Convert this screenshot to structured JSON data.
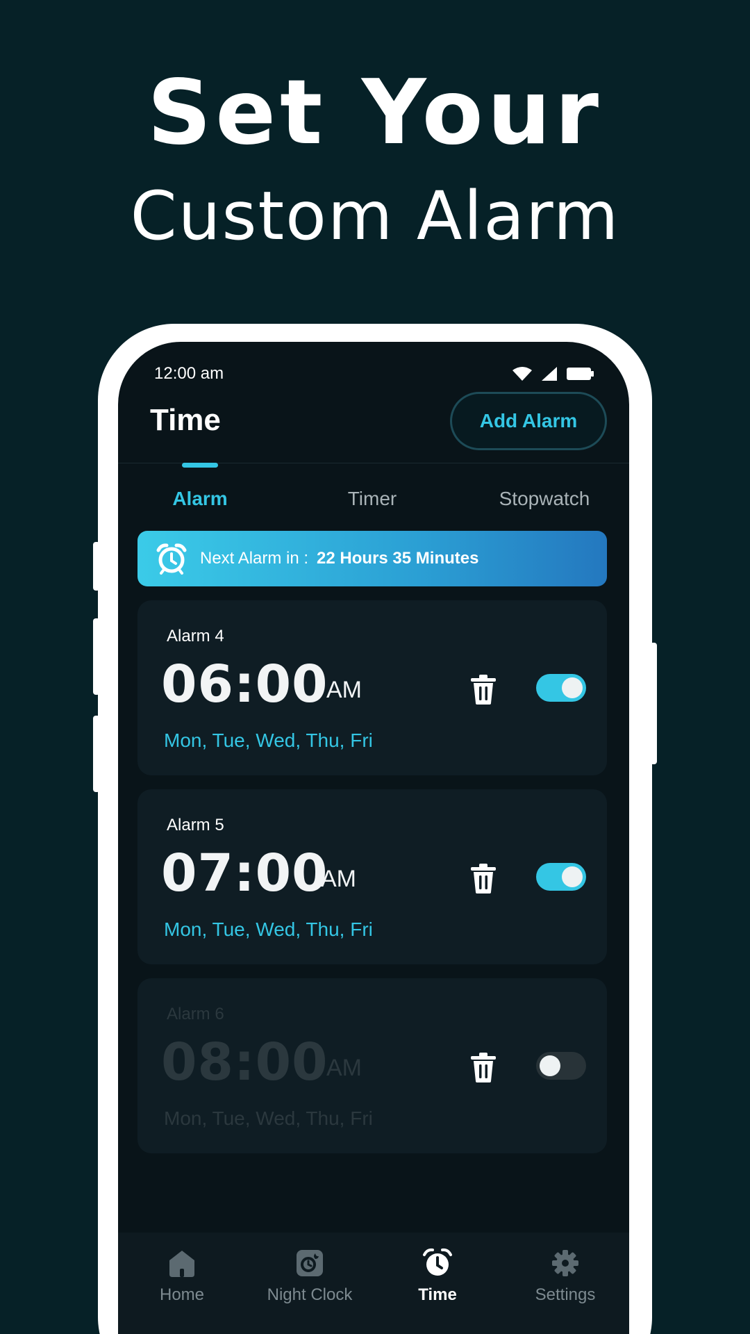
{
  "hero": {
    "line1": "Set Your",
    "line2": "Custom Alarm"
  },
  "status_bar": {
    "time": "12:00 am",
    "icons": [
      "wifi-icon",
      "signal-icon",
      "battery-icon"
    ]
  },
  "header": {
    "title": "Time",
    "add_button": "Add Alarm"
  },
  "tabs": [
    {
      "label": "Alarm",
      "active": true
    },
    {
      "label": "Timer",
      "active": false
    },
    {
      "label": "Stopwatch",
      "active": false
    }
  ],
  "next_alarm": {
    "label": "Next Alarm in :",
    "value": "22 Hours 35 Minutes"
  },
  "alarms": [
    {
      "name": "Alarm 4",
      "time": "06:00",
      "ampm": "AM",
      "days": "Mon, Tue, Wed, Thu, Fri",
      "enabled": true
    },
    {
      "name": "Alarm 5",
      "time": "07:00",
      "ampm": "AM",
      "days": "Mon, Tue, Wed, Thu, Fri",
      "enabled": true
    },
    {
      "name": "Alarm 6",
      "time": "08:00",
      "ampm": "AM",
      "days": "Mon, Tue, Wed, Thu, Fri",
      "enabled": false
    }
  ],
  "bottom_nav": [
    {
      "label": "Home",
      "icon": "home-icon",
      "active": false
    },
    {
      "label": "Night Clock",
      "icon": "night-clock-icon",
      "active": false
    },
    {
      "label": "Time",
      "icon": "alarm-clock-icon",
      "active": true
    },
    {
      "label": "Settings",
      "icon": "gear-icon",
      "active": false
    }
  ],
  "colors": {
    "background": "#062127",
    "screen": "#091419",
    "card": "#0f1d24",
    "accent": "#34c6e4"
  }
}
